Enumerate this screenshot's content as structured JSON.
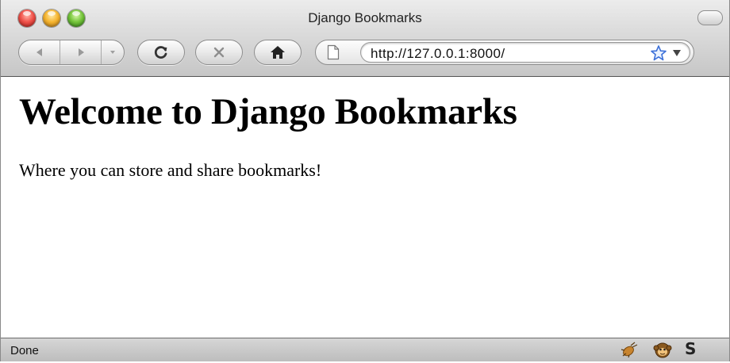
{
  "window": {
    "title": "Django Bookmarks"
  },
  "toolbar": {
    "url": "http://127.0.0.1:8000/"
  },
  "page": {
    "heading": "Welcome to Django Bookmarks",
    "tagline": "Where you can store and share bookmarks!"
  },
  "statusbar": {
    "text": "Done",
    "icons": [
      "firebug-icon",
      "greasemonkey-icon",
      "s-icon"
    ],
    "s_glyph": "S"
  },
  "colors": {
    "chrome_top": "#ececec",
    "chrome_bottom": "#c6c6c6",
    "close": "#f0524a",
    "minimize": "#f6b530",
    "zoom": "#75c53a",
    "bookmark_star": "#3b6fd8"
  }
}
